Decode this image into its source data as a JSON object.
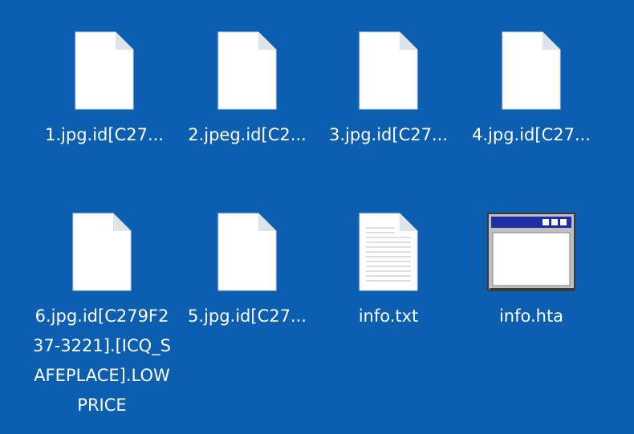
{
  "desktop": {
    "background_color": "#0c5fb0",
    "files": [
      {
        "name": "1.jpg.id[C27...",
        "icon": "blank-file-icon"
      },
      {
        "name": "2.jpeg.id[C2...",
        "icon": "blank-file-icon"
      },
      {
        "name": "3.jpg.id[C27...",
        "icon": "blank-file-icon"
      },
      {
        "name": "4.jpg.id[C27...",
        "icon": "blank-file-icon"
      },
      {
        "name": "6.jpg.id[C279F237-3221].[ICQ_SAFEPLACE].LOWPRICE",
        "icon": "blank-file-icon"
      },
      {
        "name": "5.jpg.id[C27...",
        "icon": "blank-file-icon"
      },
      {
        "name": "info.txt",
        "icon": "text-file-icon"
      },
      {
        "name": "info.hta",
        "icon": "hta-window-icon"
      }
    ]
  }
}
